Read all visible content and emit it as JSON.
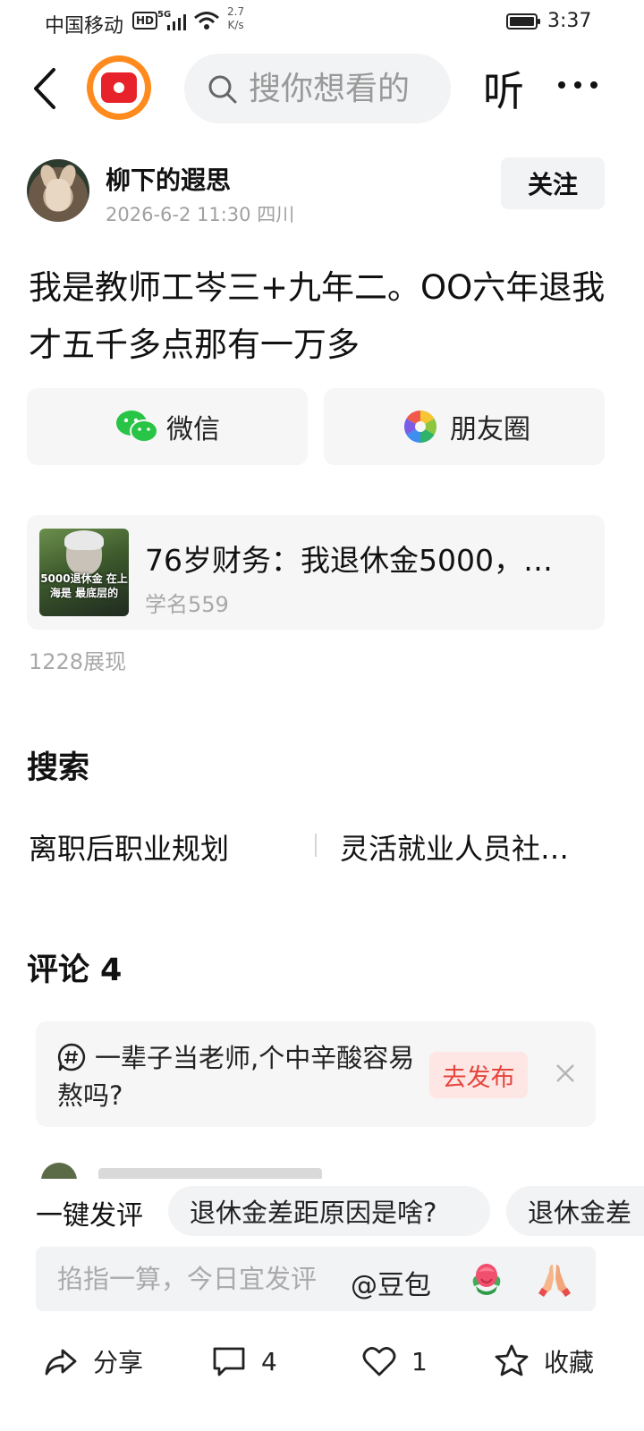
{
  "status_bar": {
    "carrier": "中国移动",
    "hd": "HD",
    "network": "5G",
    "speed_value": "2.7",
    "speed_unit": "K/s",
    "time": "3:37"
  },
  "nav": {
    "search_placeholder": "搜你想看的",
    "listen_label": "听"
  },
  "author": {
    "name": "柳下的遐思",
    "meta": "2026-6-2 11:30 四川",
    "follow_label": "关注"
  },
  "post": {
    "content": "我是教师工岑三+九年二。OO六年退我才五千多点那有一万多"
  },
  "share": {
    "wechat_label": "微信",
    "moments_label": "朋友圈"
  },
  "related": {
    "title": "76岁财务：我退休金5000，…",
    "source": "学名559",
    "thumb_text": "5000退休金 在上海是 最底层的"
  },
  "views": "1228展现",
  "search_section": {
    "title": "搜索",
    "topics": [
      "离职后职业规划",
      "灵活就业人员社…"
    ]
  },
  "comments": {
    "title": "评论",
    "count": "4",
    "prompt_text": "一辈子当老师,个中辛酸容易熬吗?",
    "publish_label": "去发布"
  },
  "quick_comment": {
    "label": "一键发评",
    "chips": [
      "退休金差距原因是啥?",
      "退休金差"
    ]
  },
  "comment_input": {
    "placeholder": "掐指一算，今日宜发评",
    "mention_label": "@豆包"
  },
  "bottom_bar": {
    "share_label": "分享",
    "comment_count": "4",
    "like_count": "1",
    "favorite_label": "收藏"
  },
  "colors": {
    "accent_red": "#e5453c",
    "logo_orange": "#ff8a1e",
    "chip_bg": "#f2f3f5"
  }
}
